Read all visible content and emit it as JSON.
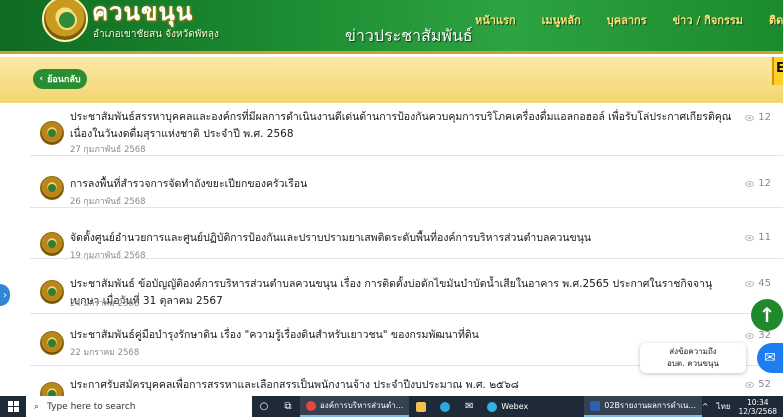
{
  "header": {
    "site_name": "ควนขนุน",
    "site_sub": "อำเภอเขาชัยสน จังหวัดพัทลุง",
    "page_title": "ข่าวประชาสัมพันธ์",
    "nav": [
      "หน้าแรก",
      "เมนูหลัก",
      "บุคลากร",
      "ข่าว / กิจกรรม",
      "ติดต่อหน่วยงาน"
    ]
  },
  "back_label": "ย้อนกลับ",
  "edge_letter": "E",
  "news": [
    {
      "title": "ประชาสัมพันธ์สรรหาบุคคลและองค์กรที่มีผลการดำเนินงานดีเด่นด้านการป้องกันควบคุมการบริโภคเครื่องดื่มแอลกอฮอล์ เพื่อรับโล่ประกาศเกียรติคุณเนื่องในวันงดดื่มสุราแห่งชาติ ประจำปี พ.ศ. 2568",
      "date": "27 กุมภาพันธ์ 2568",
      "views": "12"
    },
    {
      "title": "การลงพื้นที่สำรวจการจัดทำถังขยะเปียกของครัวเรือน",
      "date": "26 กุมภาพันธ์ 2568",
      "views": "12"
    },
    {
      "title": "จัดตั้งศูนย์อำนวยการและศูนย์ปฏิบัติการป้องกันและปราบปรามยาเสพติดระดับพื้นที่องค์การบริหารส่วนตำบลควนขนุน",
      "date": "19 กุมภาพันธ์ 2568",
      "views": "11"
    },
    {
      "title": "ประชาสัมพันธ์ ข้อบัญญัติองค์การบริหารส่วนตำบลควนขนุน เรื่อง การติดตั้งบ่อดักไขมันบำบัดน้ำเสียในอาคาร พ.ศ.2565 ประกาศในราชกิจจานุเบกษา เมื่อวันที่ 31 ตุลาคม 2567",
      "date": "24 มกราคม 2568",
      "views": "45"
    },
    {
      "title": "ประชาสัมพันธ์คู่มือบำรุงรักษาดิน เรื่อง \"ความรู้เรื่องดินสำหรับเยาวชน\" ของกรมพัฒนาที่ดิน",
      "date": "22 มกราคม 2568",
      "views": "32"
    },
    {
      "title": "ประกาศรับสมัครบุคคลเพื่อการสรรหาและเลือกสรรเป็นพนักงานจ้าง ประจำปีงบประมาณ พ.ศ. ๒๕๖๘",
      "date": "",
      "views": "52"
    }
  ],
  "chat_widget": {
    "line1": "ส่งข้อความถึง",
    "line2": "อบต. ควนขนุน"
  },
  "taskbar": {
    "search_placeholder": "Type here to search",
    "apps": [
      {
        "label": "องค์การบริหารส่วนตำ...",
        "icon": "chrome-icon",
        "color": "#e8453c"
      },
      {
        "label": "Webex",
        "icon": "webex-icon",
        "color": "#2fb3e0"
      },
      {
        "label": "02Bรายงานผลการดำเน...",
        "icon": "word-icon",
        "color": "#2b5fb4"
      }
    ],
    "lang": "ไทย",
    "time": "10:34",
    "date": "12/3/2568"
  }
}
